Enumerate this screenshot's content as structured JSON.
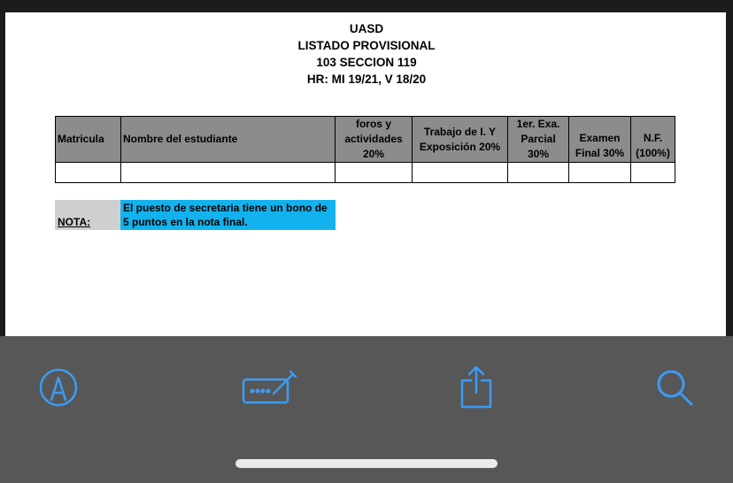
{
  "document": {
    "title_lines": [
      "UASD",
      "LISTADO PROVISIONAL",
      "103 SECCION 119",
      "HR: MI 19/21, V 18/20"
    ],
    "table": {
      "headers": [
        "Matricula",
        "Nombre del estudiante",
        "foros y actividades 20%",
        "Trabajo de I. Y Exposición 20%",
        "1er. Exa. Parcial 30%",
        "Examen Final 30%",
        "N.F. (100%)"
      ],
      "rows": [
        [
          "",
          "",
          "",
          "",
          "",
          "",
          ""
        ]
      ]
    },
    "note": {
      "label": "NOTA:",
      "text": "El puesto de secretaria tiene un bono de 5 puntos en la nota final.",
      "highlight_color": "#12b2ee"
    }
  },
  "toolbar": {
    "accent_color": "#3b9bf5",
    "items": [
      {
        "icon": "markup-icon"
      },
      {
        "icon": "signature-icon"
      },
      {
        "icon": "share-icon"
      },
      {
        "icon": "search-icon"
      }
    ]
  }
}
